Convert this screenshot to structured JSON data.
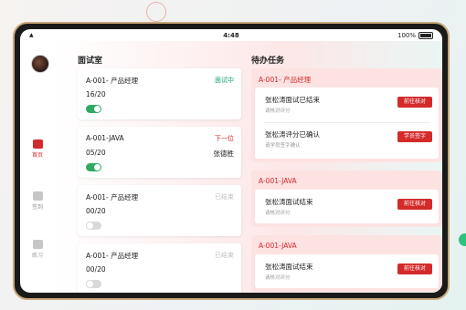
{
  "statusbar": {
    "time": "4:48",
    "battery": "100%"
  },
  "nav": [
    {
      "label": "首页",
      "active": true,
      "icon": "home-icon"
    },
    {
      "label": "签到",
      "active": false,
      "icon": "checkin-icon"
    },
    {
      "label": "练习",
      "active": false,
      "icon": "practice-icon"
    }
  ],
  "interview_room": {
    "title": "面试室",
    "cards": [
      {
        "name": "A-001- 产品经理",
        "status": "面试中",
        "status_color": "#1aa36b",
        "count": "16/20",
        "person": "",
        "toggle": true
      },
      {
        "name": "A-001-JAVA",
        "status": "下一位",
        "status_color": "#d42a2a",
        "count": "05/20",
        "person": "张德胜",
        "toggle": true
      },
      {
        "name": "A-001- 产品经理",
        "status": "已结束",
        "status_color": "#c0c0c0",
        "count": "00/20",
        "person": "",
        "toggle": false
      },
      {
        "name": "A-001- 产品经理",
        "status": "已结束",
        "status_color": "#c0c0c0",
        "count": "00/20",
        "person": "",
        "toggle": false
      }
    ]
  },
  "todo": {
    "title": "待办任务",
    "groups": [
      {
        "title": "A-001- 产品经理",
        "tasks": [
          {
            "text": "张松涛面试已结束",
            "sub": "请核对评分",
            "button": "前往核对"
          },
          {
            "text": "张松涛评分已确认",
            "sub": "请学员签字确认",
            "button": "学员签字"
          }
        ]
      },
      {
        "title": "A-001-JAVA",
        "tasks": [
          {
            "text": "张松涛面试结束",
            "sub": "请核对评分",
            "button": "前往核对"
          }
        ]
      },
      {
        "title": "A-001-JAVA",
        "tasks": [
          {
            "text": "张松涛面试结束",
            "sub": "请核对评分",
            "button": "前往核对"
          }
        ]
      }
    ]
  }
}
